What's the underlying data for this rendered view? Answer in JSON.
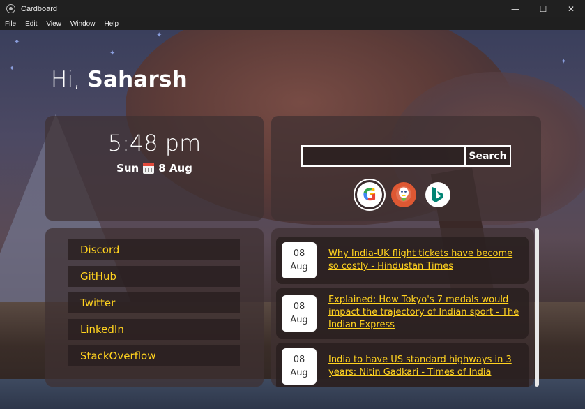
{
  "window": {
    "title": "Cardboard",
    "minimize_icon": "—",
    "maximize_icon": "☐",
    "close_icon": "✕"
  },
  "menu": [
    "File",
    "Edit",
    "View",
    "Window",
    "Help"
  ],
  "greeting": {
    "prefix": "Hi, ",
    "name": "Saharsh"
  },
  "clock": {
    "time": "5:48 pm",
    "day": "Sun",
    "date": "8 Aug"
  },
  "search": {
    "value": "",
    "button_label": "Search",
    "selected_engine": "google",
    "engines": [
      "google",
      "duckduckgo",
      "bing"
    ]
  },
  "links": [
    "Discord",
    "GitHub",
    "Twitter",
    "LinkedIn",
    "StackOverflow"
  ],
  "news": [
    {
      "day": "08",
      "month": "Aug",
      "headline": "Why India-UK flight tickets have become so costly - Hindustan Times"
    },
    {
      "day": "08",
      "month": "Aug",
      "headline": "Explained: How Tokyo's 7 medals would impact the trajectory of Indian sport - The Indian Express"
    },
    {
      "day": "08",
      "month": "Aug",
      "headline": "India to have US standard highways in 3 years: Nitin Gadkari - Times of India"
    }
  ],
  "colors": {
    "link_accent": "#ffd21f",
    "titlebar": "#202020",
    "panel": "rgba(62,48,50,0.72)"
  }
}
